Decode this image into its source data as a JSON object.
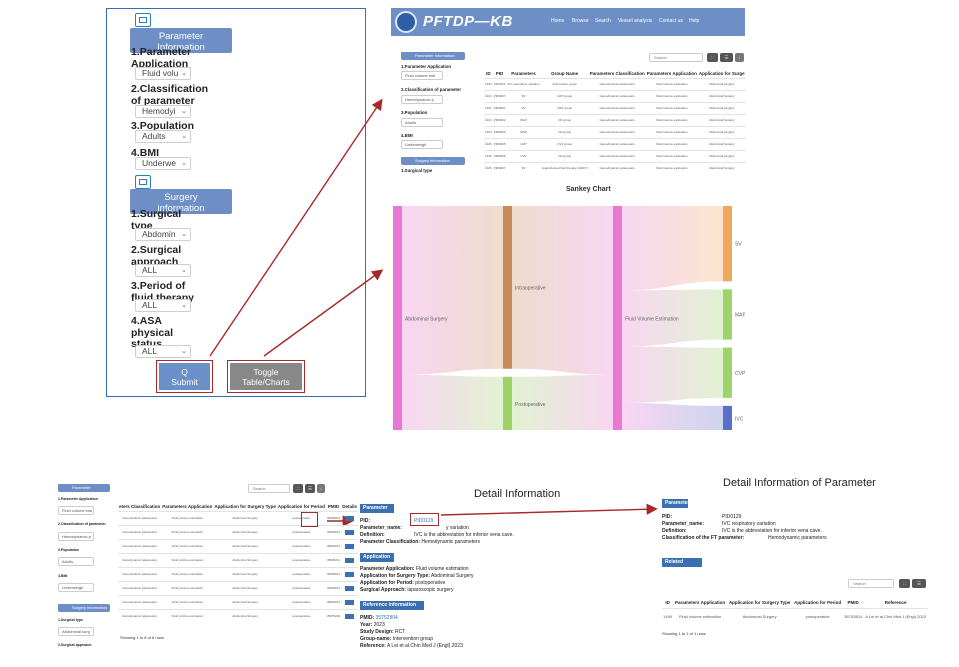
{
  "left_panel": {
    "parameter_section": {
      "title_line1": "Parameter",
      "title_line2": "Information",
      "fields": [
        {
          "label_line1": "1.Parameter",
          "label_line2": "Application",
          "value": "Fluid volu"
        },
        {
          "label_line1": "2.Classification",
          "label_line2": "of parameter",
          "value": "Hemodyi"
        },
        {
          "label_line1": "3.Population",
          "label_line2": "",
          "value": "Adults"
        },
        {
          "label_line1": "4.BMI",
          "label_line2": "",
          "value": "Underwe"
        }
      ]
    },
    "surgery_section": {
      "title_line1": "Surgery",
      "title_line2": "information",
      "fields": [
        {
          "label_line1": "1.Surgical",
          "label_line2": "type",
          "label_line3": "",
          "value": "Abdomin"
        },
        {
          "label_line1": "2.Surgical",
          "label_line2": "approach",
          "label_line3": "",
          "value": "ALL"
        },
        {
          "label_line1": "3.Period of",
          "label_line2": "fluid therapy",
          "label_line3": "",
          "value": "ALL"
        },
        {
          "label_line1": "4.ASA",
          "label_line2": "physical",
          "label_line3": "status",
          "value": "ALL"
        }
      ]
    },
    "submit_icon": "Q",
    "submit_label": "Submit",
    "toggle_line1": "Toggle",
    "toggle_line2": "Table/Charts"
  },
  "app": {
    "brand": "PFTDP—KB",
    "nav": [
      "Home",
      "Browse",
      "Search",
      "Vessel analysis",
      "Contact us",
      "Help"
    ],
    "sidebar": {
      "param_head": "Parameter information",
      "labels": [
        "1.Parameter Application",
        "2.Classification of parameter",
        "3.Population",
        "4.BMI"
      ],
      "values": [
        "Fluid volume esti",
        "Hemodynamic p",
        "Adults",
        "Underweigh"
      ],
      "surgery_head": "Surgery information",
      "surgery_label": "1.Surgical type"
    },
    "search_placeholder": "Search",
    "table": {
      "headers": [
        "ID",
        "PID",
        "Parameters",
        "Group Name",
        "Parameters Classification",
        "Parameters Application",
        "Application for Surge"
      ],
      "rows": [
        [
          "1403",
          "PID0119",
          "IVC respiratory variation",
          "Intervention group",
          "Hemodynamic parameters",
          "Fluid volume estimation",
          "Abdominal Surgery"
        ],
        [
          "1404",
          "PID0007",
          "SV",
          "GDT group",
          "Hemodynamic parameters",
          "Fluid volume estimation",
          "Abdominal Surgery"
        ],
        [
          "1407",
          "PID0007",
          "SV",
          "GDT group",
          "Hemodynamic parameters",
          "Fluid volume estimation",
          "Abdominal Surgery"
        ],
        [
          "1404",
          "PID0002",
          "MAP",
          "CD group",
          "Hemodynamic parameters",
          "Fluid volume estimation",
          "Abdominal Surgery"
        ],
        [
          "1404",
          "PID0002",
          "MAP",
          "CD group",
          "Hemodynamic parameters",
          "Fluid volume estimation",
          "Abdominal Surgery"
        ],
        [
          "1406",
          "PID0005",
          "CVP",
          "CVV group",
          "Hemodynamic parameters",
          "Fluid volume estimation",
          "Abdominal Surgery"
        ],
        [
          "1406",
          "PID0005",
          "CVP",
          "CD group",
          "Hemodynamic parameters",
          "Fluid volume estimation",
          "Abdominal Surgery"
        ],
        [
          "1406",
          "PID0007",
          "SV",
          "Goal-directed fluid therapy (GDFT)",
          "Hemodynamic parameters",
          "Fluid volume estimation",
          "Abdominal Surgery"
        ]
      ]
    }
  },
  "sankey": {
    "title": "Sankey Chart",
    "nodes": [
      {
        "id": "abdominal",
        "label": "Abdominal Surgery",
        "color": "#e878d4"
      },
      {
        "id": "intra",
        "label": "Intraoperative",
        "color": "#c98a5a"
      },
      {
        "id": "post",
        "label": "Postoperative",
        "color": "#9ed36a"
      },
      {
        "id": "fluid",
        "label": "Fluid Volume Estimation",
        "color": "#e878d4"
      },
      {
        "id": "sv",
        "label": "SV",
        "color": "#f0a85a"
      },
      {
        "id": "map",
        "label": "MAP",
        "color": "#9ed36a"
      },
      {
        "id": "cvp",
        "label": "CVP",
        "color": "#9ed36a"
      },
      {
        "id": "ivc",
        "label": "IVC respiratory variation",
        "color": "#5a6fc8"
      }
    ],
    "links": [
      {
        "source": "abdominal",
        "target": "intra",
        "value": 6
      },
      {
        "source": "abdominal",
        "target": "post",
        "value": 2
      },
      {
        "source": "intra",
        "target": "fluid",
        "value": 6
      },
      {
        "source": "post",
        "target": "fluid",
        "value": 2
      },
      {
        "source": "fluid",
        "target": "sv",
        "value": 3
      },
      {
        "source": "fluid",
        "target": "map",
        "value": 2
      },
      {
        "source": "fluid",
        "target": "cvp",
        "value": 2
      },
      {
        "source": "fluid",
        "target": "ivc",
        "value": 1
      }
    ]
  },
  "bottom_left": {
    "param_head": "Parameter information",
    "labels": [
      "1.Parameter Application",
      "2.Classification of parameter",
      "3.Population",
      "4.BMI"
    ],
    "values": [
      "Fluid volume esti",
      "Hemodynamic p",
      "Adults",
      "Underweigh"
    ],
    "surgery_head": "Surgery information",
    "surgery_labels": [
      "1.Surgical type",
      "2.Surgical approach"
    ],
    "surgery_values": [
      "Abdominal surg"
    ],
    "search_placeholder": "Search",
    "headers": [
      "eters Classification",
      "Parameters Application",
      "Application for Surgery Type",
      "Application for Period",
      "PMID",
      "Details"
    ],
    "rows": [
      [
        "hemodynamic parameters",
        "Fluid volume estimation",
        "Abdominal Surgery",
        "postoperative",
        "35935211"
      ],
      [
        "hemodynamic parameters",
        "Fluid volume estimation",
        "Abdominal Surgery",
        "postoperative",
        "35935211"
      ],
      [
        "hemodynamic parameters",
        "Fluid volume estimation",
        "Abdominal Surgery",
        "postoperative",
        "35935211"
      ],
      [
        "hemodynamic parameters",
        "Fluid volume estimation",
        "Abdominal Surgery",
        "postoperative",
        "35935211"
      ],
      [
        "hemodynamic parameters",
        "Fluid volume estimation",
        "Abdominal Surgery",
        "postoperative",
        "35935211"
      ],
      [
        "hemodynamic parameters",
        "Fluid volume estimation",
        "Abdominal Surgery",
        "postoperative",
        "35935211"
      ],
      [
        "hemodynamic parameters",
        "Fluid volume estimation",
        "Abdominal Surgery",
        "postoperative",
        "35935211"
      ],
      [
        "hemodynamic parameters",
        "Fluid volume estimation",
        "Abdominal Surgery",
        "postoperative",
        "35975204"
      ]
    ],
    "footer": "Showing 1 to 8 of 8 rows"
  },
  "detail": {
    "title": "Detail Information",
    "parameter_head": "Parameter",
    "pid_label": "PID:",
    "pid_value": "PID0129",
    "name_label": "Parameter_name:",
    "name_value": "y variation",
    "def_label": "Definition:",
    "def_value": "IVC is the abbreviation for inferior vena cave.",
    "class_label": "Parameter Classification:",
    "class_value": "Hemodynamic parameters",
    "application_head": "Application",
    "app_rows": [
      {
        "label": "Parameter Application:",
        "value": "Fluid volume estimation"
      },
      {
        "label": "Application for Surgery Type:",
        "value": "Abdominal Surgery"
      },
      {
        "label": "Application for Period:",
        "value": "postoperative"
      },
      {
        "label": "Surgical Approach:",
        "value": "laparoscopic surgery"
      }
    ],
    "ref_head": "Reference information",
    "ref_rows": [
      {
        "label": "PMID:",
        "value": "35752804"
      },
      {
        "label": "Year:",
        "value": "2023"
      },
      {
        "label": "Study Design:",
        "value": "RCT"
      },
      {
        "label": "Group-name:",
        "value": "Intervention group"
      },
      {
        "label": "Reference:",
        "value": "A Lei et al.Chin Med J (Engl).2023"
      }
    ]
  },
  "detail2": {
    "title": "Detail Information of Parameter",
    "parameter_head": "Parameter",
    "rows": [
      {
        "label": "PID:",
        "value": "PID0129"
      },
      {
        "label": "Parameter_name:",
        "value": "IVC respiratory variation"
      },
      {
        "label": "Definition:",
        "value": "IVC is the abbreviation for inferior vena cave."
      },
      {
        "label": "Classification of the FT parameter:",
        "value": "Hemodynamic parameters"
      }
    ],
    "related_head": "Related Studies",
    "search_placeholder": "Search",
    "headers": [
      "ID",
      "Parameters Application",
      "Application for Surgery Type",
      "Application for Period",
      "PMID",
      "Reference"
    ],
    "row": [
      "1490",
      "Fluid volume estimation",
      "Abdominal Surgery",
      "postoperative",
      "35752804",
      "A Lei et al.Chin Med J (Engl).2023"
    ],
    "footer": "Showing 1 to 1 of 1 rows"
  }
}
